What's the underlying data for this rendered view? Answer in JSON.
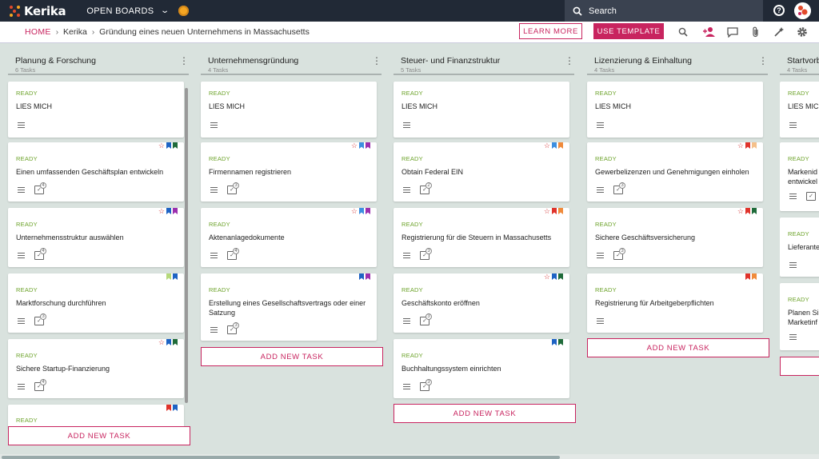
{
  "app": {
    "logo_text": "Kerika",
    "open_boards_label": "OPEN BOARDS",
    "search_placeholder": "Search"
  },
  "breadcrumb": {
    "home": "HOME",
    "account": "Kerika",
    "board": "Gründung eines neuen Unternehmens in Massachusetts"
  },
  "toolbar": {
    "learn_more": "LEARN MORE",
    "use_template": "USE TEMPLATE"
  },
  "colors": {
    "accent": "#c8245f",
    "ready": "#6ca32a",
    "topbar": "#212936",
    "board_bg": "#d9e2de"
  },
  "columns": [
    {
      "title": "Planung & Forschung",
      "count": "6 Tasks",
      "add_label": "ADD NEW TASK",
      "cards": [
        {
          "status": "READY",
          "title": "LIES MICH"
        },
        {
          "status": "READY",
          "title": "Einen umfassenden Geschäftsplan entwickeln",
          "checks": "4"
        },
        {
          "status": "READY",
          "title": "Unternehmensstruktur auswählen",
          "checks": "4"
        },
        {
          "status": "READY",
          "title": "Marktforschung durchführen",
          "checks": "3"
        },
        {
          "status": "READY",
          "title": "Sichere Startup-Finanzierung",
          "checks": "4"
        },
        {
          "status": "READY",
          "title": ""
        }
      ]
    },
    {
      "title": "Unternehmensgründung",
      "count": "4 Tasks",
      "add_label": "ADD NEW TASK",
      "cards": [
        {
          "status": "READY",
          "title": "LIES MICH"
        },
        {
          "status": "READY",
          "title": "Firmennamen registrieren",
          "checks": "3"
        },
        {
          "status": "READY",
          "title": "Aktenanlagedokumente",
          "checks": "4"
        },
        {
          "status": "READY",
          "title": "Erstellung eines Gesellschaftsvertrags oder einer Satzung",
          "checks": "3"
        }
      ]
    },
    {
      "title": "Steuer- und Finanzstruktur",
      "count": "5 Tasks",
      "add_label": "ADD NEW TASK",
      "cards": [
        {
          "status": "READY",
          "title": "LIES MICH"
        },
        {
          "status": "READY",
          "title": "Obtain Federal EIN",
          "checks": "2"
        },
        {
          "status": "READY",
          "title": "Registrierung für die Steuern in Massachusetts",
          "checks": "3"
        },
        {
          "status": "READY",
          "title": "Geschäftskonto eröffnen",
          "checks": "3"
        },
        {
          "status": "READY",
          "title": "Buchhaltungssystem einrichten",
          "checks": "3"
        }
      ]
    },
    {
      "title": "Lizenzierung & Einhaltung",
      "count": "4 Tasks",
      "add_label": "ADD NEW TASK",
      "cards": [
        {
          "status": "READY",
          "title": "LIES MICH"
        },
        {
          "status": "READY",
          "title": "Gewerbelizenzen und Genehmigungen einholen",
          "checks": "3"
        },
        {
          "status": "READY",
          "title": "Sichere Geschäftsversicherung",
          "checks": "3"
        },
        {
          "status": "READY",
          "title": "Registrierung für Arbeitgeberpflichten"
        }
      ]
    },
    {
      "title": "Startvorb",
      "count": "4 Tasks",
      "cards": [
        {
          "status": "READY",
          "title": "LIES MICH"
        },
        {
          "status": "READY",
          "title": "Markenid entwickel"
        },
        {
          "status": "READY",
          "title": "Lieferante"
        },
        {
          "status": "READY",
          "title": "Planen Si Marketinf"
        }
      ]
    }
  ]
}
